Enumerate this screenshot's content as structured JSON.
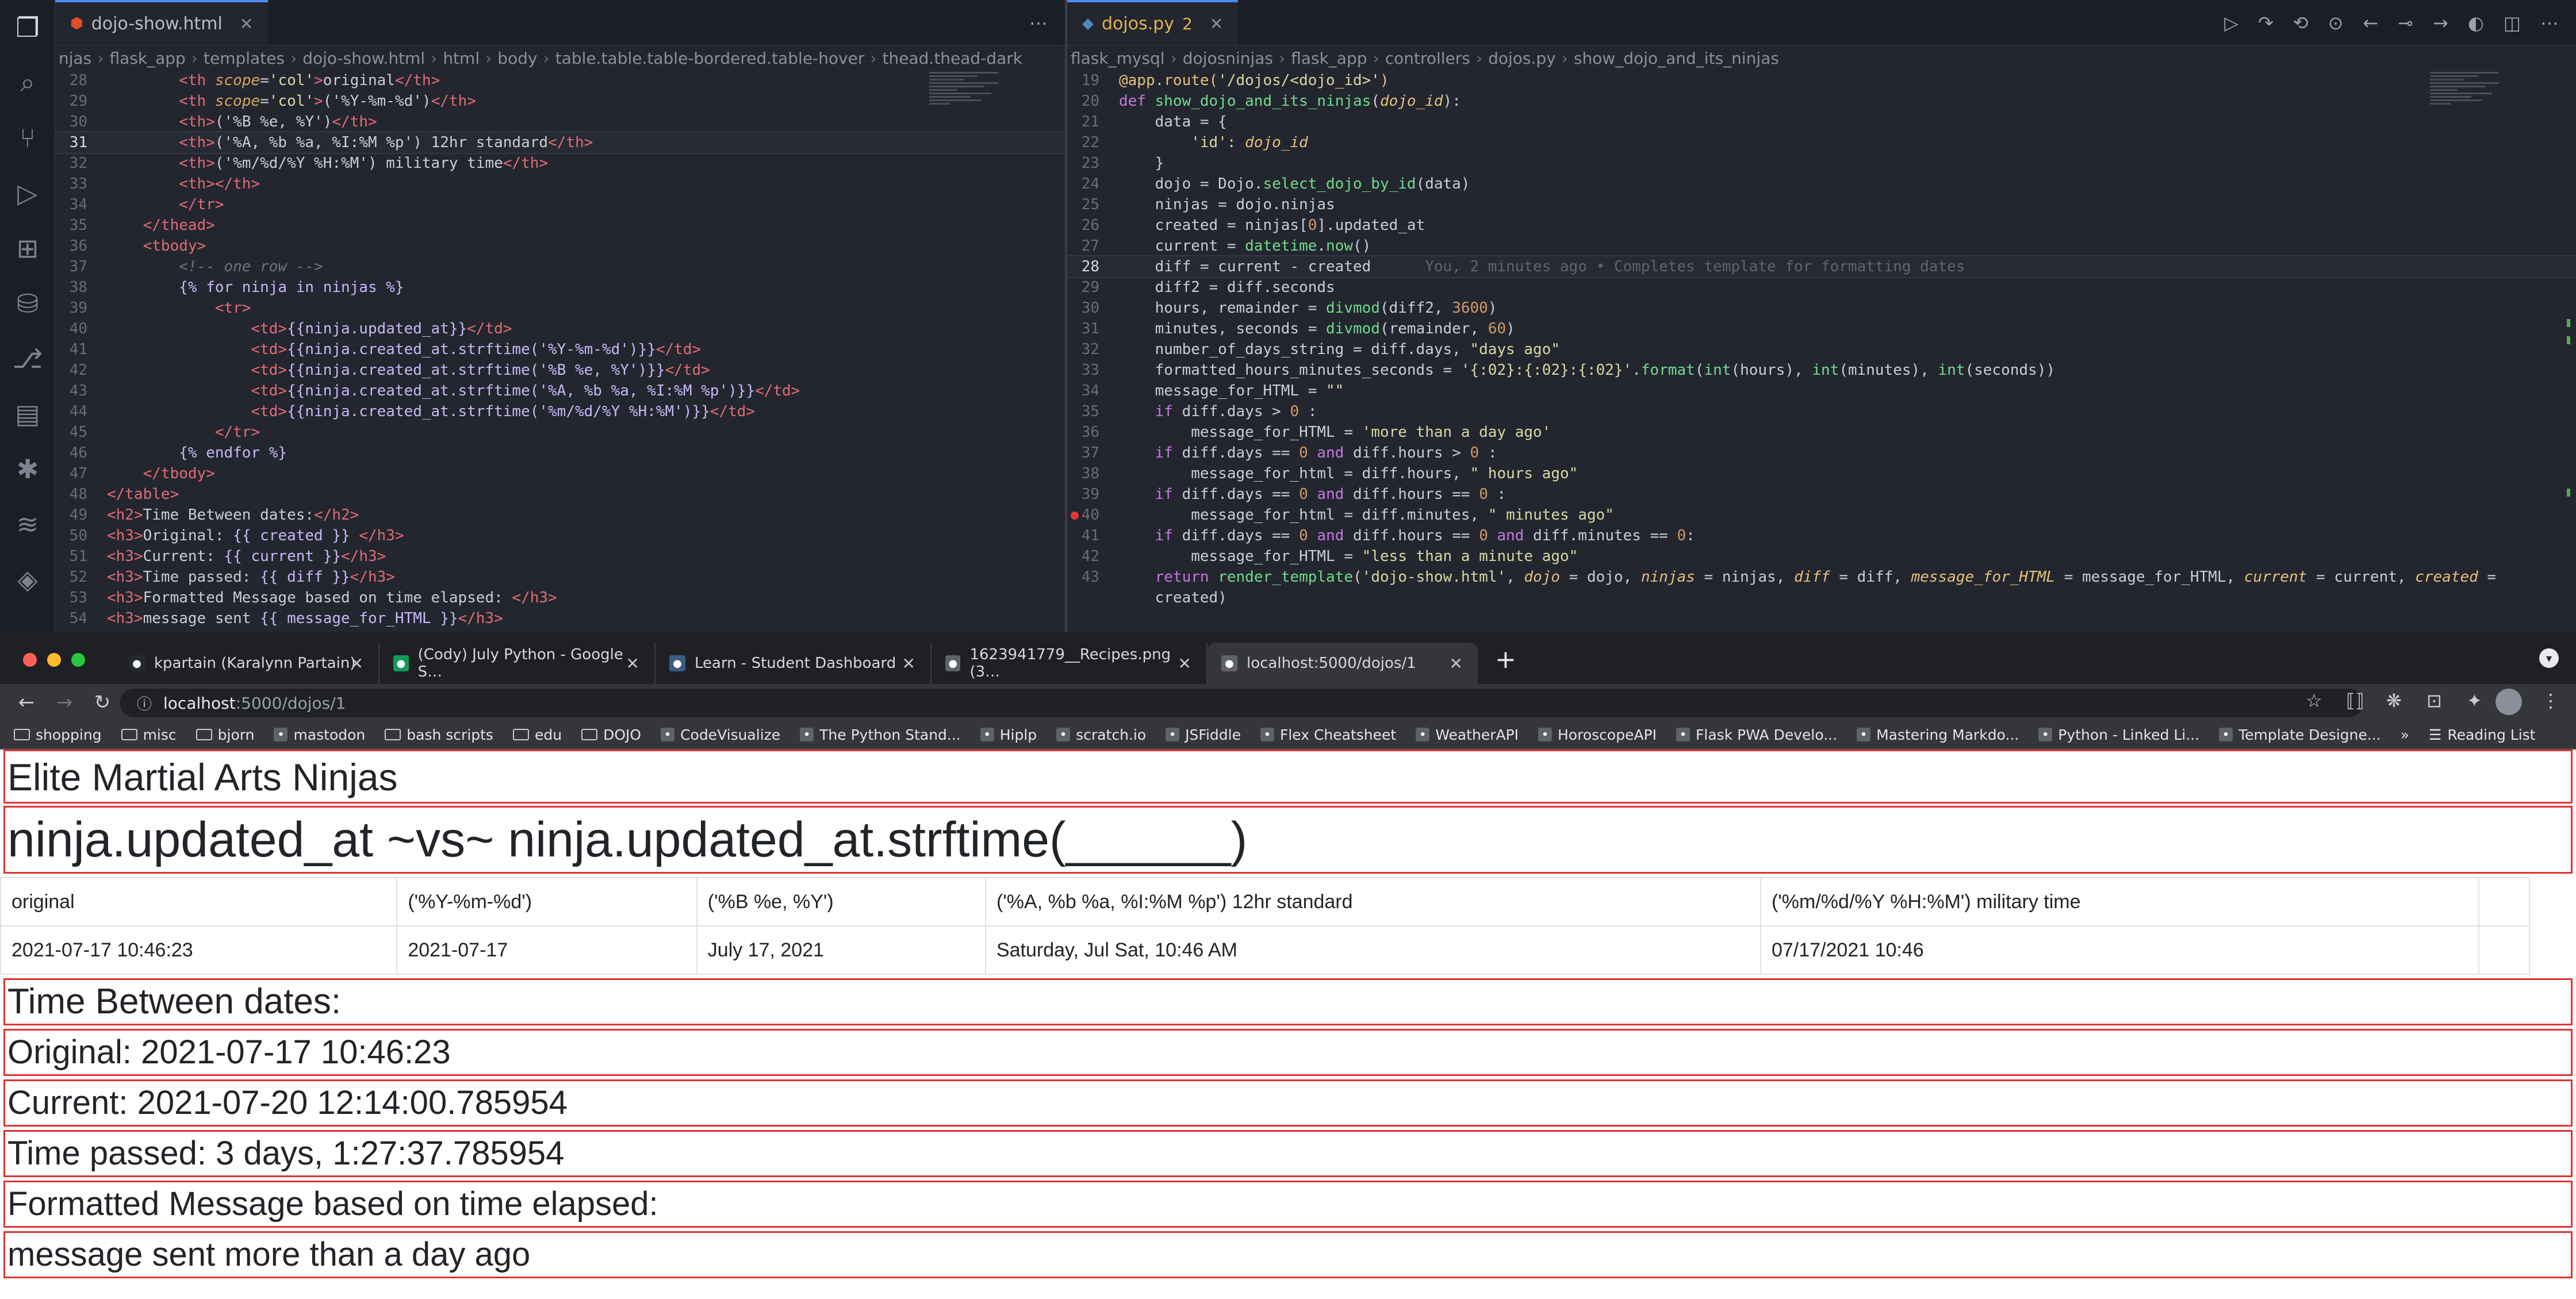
{
  "activity_bar": [
    "files-icon",
    "search-icon",
    "source-control-icon",
    "run-debug-icon",
    "extensions-icon",
    "database-icon",
    "git-graph-icon",
    "preview-icon",
    "paw-icon",
    "db-stack-icon",
    "layers-icon"
  ],
  "left_editor": {
    "tab_label": "dojo-show.html",
    "breadcrumbs": [
      "njas",
      "flask_app",
      "templates",
      "dojo-show.html",
      "html",
      "body",
      "table.table.table-bordered.table-hover",
      "thead.thead-dark"
    ],
    "lines": [
      {
        "n": "28",
        "html": "        <span class='t-tag'>&lt;th</span> <span class='t-attr'>scope</span>=<span class='t-str'>'col'</span><span class='t-tag'>&gt;</span>original<span class='t-tag'>&lt;/th&gt;</span>"
      },
      {
        "n": "29",
        "html": "        <span class='t-tag'>&lt;th</span> <span class='t-attr'>scope</span>=<span class='t-str'>'col'</span><span class='t-tag'>&gt;</span>('%Y-%m-%d')<span class='t-tag'>&lt;/th&gt;</span>"
      },
      {
        "n": "30",
        "html": "        <span class='t-tag'>&lt;th&gt;</span>('%B %e, %Y')<span class='t-tag'>&lt;/th&gt;</span>"
      },
      {
        "n": "31",
        "cur": true,
        "html": "        <span class='t-tag'>&lt;th&gt;</span>('%A, %b %a, %I:%M %p') 12hr standard<span class='t-tag'>&lt;/th&gt;</span>"
      },
      {
        "n": "32",
        "html": "        <span class='t-tag'>&lt;th&gt;</span>('%m/%d/%Y %H:%M') military time<span class='t-tag'>&lt;/th&gt;</span>"
      },
      {
        "n": "33",
        "html": "        <span class='t-tag'>&lt;th&gt;&lt;/th&gt;</span>"
      },
      {
        "n": "34",
        "html": "        <span class='t-tag'>&lt;/tr&gt;</span>"
      },
      {
        "n": "35",
        "html": "    <span class='t-tag'>&lt;/thead&gt;</span>"
      },
      {
        "n": "36",
        "html": "    <span class='t-tag'>&lt;tbody&gt;</span>"
      },
      {
        "n": "37",
        "html": "        <span class='t-com'>&lt;!-- one row --&gt;</span>"
      },
      {
        "n": "38",
        "html": "        <span class='t-tpl'>{% for ninja in ninjas %}</span>"
      },
      {
        "n": "39",
        "html": "            <span class='t-tag'>&lt;tr&gt;</span>"
      },
      {
        "n": "40",
        "html": "                <span class='t-tag'>&lt;td&gt;</span><span class='t-tpl'>{{ninja.updated_at}}</span><span class='t-tag'>&lt;/td&gt;</span>"
      },
      {
        "n": "41",
        "html": "                <span class='t-tag'>&lt;td&gt;</span><span class='t-tpl'>{{ninja.created_at.strftime('%Y-%m-%d')}}</span><span class='t-tag'>&lt;/td&gt;</span>"
      },
      {
        "n": "42",
        "html": "                <span class='t-tag'>&lt;td&gt;</span><span class='t-tpl'>{{ninja.created_at.strftime('%B %e, %Y')}}</span><span class='t-tag'>&lt;/td&gt;</span>"
      },
      {
        "n": "43",
        "html": "                <span class='t-tag'>&lt;td&gt;</span><span class='t-tpl'>{{ninja.created_at.strftime('%A, %b %a, %I:%M %p')}}</span><span class='t-tag'>&lt;/td&gt;</span>"
      },
      {
        "n": "44",
        "html": "                <span class='t-tag'>&lt;td&gt;</span><span class='t-tpl'>{{ninja.created_at.strftime('%m/%d/%Y %H:%M')}}</span><span class='t-tag'>&lt;/td&gt;</span>"
      },
      {
        "n": "45",
        "html": "            <span class='t-tag'>&lt;/tr&gt;</span>"
      },
      {
        "n": "46",
        "html": "        <span class='t-tpl'>{% endfor %}</span>"
      },
      {
        "n": "47",
        "html": "    <span class='t-tag'>&lt;/tbody&gt;</span>"
      },
      {
        "n": "48",
        "html": "<span class='t-tag'>&lt;/table&gt;</span>"
      },
      {
        "n": "49",
        "html": "<span class='t-tag'>&lt;h2&gt;</span>Time Between dates:<span class='t-tag'>&lt;/h2&gt;</span>"
      },
      {
        "n": "50",
        "html": "<span class='t-tag'>&lt;h3&gt;</span>Original: <span class='t-tpl'>{{ created }}</span> <span class='t-tag'>&lt;/h3&gt;</span>"
      },
      {
        "n": "51",
        "html": "<span class='t-tag'>&lt;h3&gt;</span>Current: <span class='t-tpl'>{{ current }}</span><span class='t-tag'>&lt;/h3&gt;</span>"
      },
      {
        "n": "52",
        "html": "<span class='t-tag'>&lt;h3&gt;</span>Time passed: <span class='t-tpl'>{{ diff }}</span><span class='t-tag'>&lt;/h3&gt;</span>"
      },
      {
        "n": "53",
        "html": "<span class='t-tag'>&lt;h3&gt;</span>Formatted Message based on time elapsed: <span class='t-tag'>&lt;/h3&gt;</span>"
      },
      {
        "n": "54",
        "html": "<span class='t-tag'>&lt;h3&gt;</span>message sent <span class='t-tpl'>{{ message_for_HTML }}</span><span class='t-tag'>&lt;/h3&gt;</span>"
      }
    ]
  },
  "right_editor": {
    "tab_label": "dojos.py",
    "tab_badge": "2",
    "breadcrumbs": [
      "flask_mysql",
      "dojosninjas",
      "flask_app",
      "controllers",
      "dojos.py",
      "show_dojo_and_its_ninjas"
    ],
    "lines": [
      {
        "n": "19",
        "html": "<span class='t-dec'>@app.route(</span><span class='t-str'>'/dojos/&lt;dojo_id&gt;'</span><span class='t-dec'>)</span>"
      },
      {
        "n": "20",
        "html": "<span class='t-kw'>def</span> <span class='t-fn'>show_dojo_and_its_ninjas</span>(<span class='t-param'>dojo_id</span>):"
      },
      {
        "n": "21",
        "html": "    data = {"
      },
      {
        "n": "22",
        "html": "        <span class='t-str'>'id'</span>: <span class='t-param'>dojo_id</span>"
      },
      {
        "n": "23",
        "html": "    }"
      },
      {
        "n": "24",
        "html": "    dojo = Dojo.<span class='t-fn'>select_dojo_by_id</span>(data)"
      },
      {
        "n": "25",
        "html": "    ninjas = dojo.ninjas"
      },
      {
        "n": "26",
        "html": "    created = ninjas[<span class='t-num'>0</span>].updated_at"
      },
      {
        "n": "27",
        "html": "    current = <span class='t-fn'>datetime</span>.<span class='t-fn'>now</span>()"
      },
      {
        "n": "28",
        "cur": true,
        "html": "    diff = current - created      <span class='t-blame'>You, 2 minutes ago • Completes template for formatting dates</span>"
      },
      {
        "n": "29",
        "html": "    diff2 = diff.seconds"
      },
      {
        "n": "30",
        "html": "    hours, remainder = <span class='t-fn'>divmod</span>(diff2, <span class='t-num'>3600</span>)"
      },
      {
        "n": "31",
        "html": "    minutes, seconds = <span class='t-fn'>divmod</span>(remainder, <span class='t-num'>60</span>)"
      },
      {
        "n": "32",
        "html": "    number_of_days_string = diff.days, <span class='t-str'>\"days ago\"</span>"
      },
      {
        "n": "33",
        "html": "    formatted_hours_minutes_seconds = <span class='t-str'>'{:02}:{:02}:{:02}'</span>.<span class='t-fn'>format</span>(<span class='t-fn'>int</span>(hours), <span class='t-fn'>int</span>(minutes), <span class='t-fn'>int</span>(seconds))"
      },
      {
        "n": "34",
        "html": "    message_for_HTML = <span class='t-str'>\"\"</span>"
      },
      {
        "n": "35",
        "html": "    <span class='t-kw'>if</span> diff.days &gt; <span class='t-num'>0</span> :"
      },
      {
        "n": "36",
        "html": "        message_for_HTML = <span class='t-str'>'more than a day ago'</span>"
      },
      {
        "n": "37",
        "html": "    <span class='t-kw'>if</span> diff.days == <span class='t-num'>0</span> <span class='t-kw'>and</span> diff.hours &gt; <span class='t-num'>0</span> :"
      },
      {
        "n": "38",
        "html": "        message_for_html = diff.hours, <span class='t-str'>\" hours ago\"</span>"
      },
      {
        "n": "39",
        "html": "    <span class='t-kw'>if</span> diff.days == <span class='t-num'>0</span> <span class='t-kw'>and</span> diff.hours == <span class='t-num'>0</span> :"
      },
      {
        "n": "40",
        "bp": true,
        "html": "        message_for_html = diff.minutes, <span class='t-str'>\" minutes ago\"</span>"
      },
      {
        "n": "41",
        "html": "    <span class='t-kw'>if</span> diff.days == <span class='t-num'>0</span> <span class='t-kw'>and</span> diff.hours == <span class='t-num'>0</span> <span class='t-kw'>and</span> diff.minutes == <span class='t-num'>0</span>:"
      },
      {
        "n": "42",
        "html": "        message_for_HTML = <span class='t-str'>\"less than a minute ago\"</span>"
      },
      {
        "n": "43",
        "html": "    <span class='t-kw'>return</span> <span class='t-fn'>render_template</span>(<span class='t-str'>'dojo-show.html'</span>, <span class='t-var'>dojo</span> = dojo, <span class='t-var'>ninjas</span> = ninjas, <span class='t-var'>diff</span> = diff, <span class='t-var'>message_for_HTML</span> = message_for_HTML, <span class='t-var'>current</span> = current, <span class='t-var'>created</span> ="
      },
      {
        "n": "",
        "html": "    created)"
      }
    ]
  },
  "browser": {
    "tabs": [
      {
        "label": "kpartain (Karalynn Partain)",
        "icon": "github-icon",
        "color": "#24292e"
      },
      {
        "label": "(Cody) July Python - Google S…",
        "icon": "sheets-icon",
        "color": "#0f9d58"
      },
      {
        "label": "Learn - Student Dashboard",
        "icon": "learn-icon",
        "color": "#3d5a80"
      },
      {
        "label": "1623941779__Recipes.png (3…",
        "icon": "globe-icon",
        "color": "#5f6368"
      },
      {
        "label": "localhost:5000/dojos/1",
        "icon": "page-icon",
        "color": "#5f6368"
      }
    ],
    "url_host": "localhost",
    "url_path": ":5000/dojos/1",
    "bookmarks": [
      "shopping",
      "misc",
      "bjorn",
      "mastodon",
      "bash scripts",
      "edu",
      "DOJO",
      "CodeVisualize",
      "The Python Stand...",
      "Hiplp",
      "scratch.io",
      "JSFiddle",
      "Flex Cheatsheet",
      "WeatherAPI",
      "HoroscopeAPI",
      "Flask PWA Develo...",
      "Mastering Markdo...",
      "Python - Linked Li...",
      "Template Designe..."
    ],
    "bookmarks_more": "»",
    "reading_list": "Reading List"
  },
  "page": {
    "title": "Elite Martial Arts Ninjas",
    "subtitle": "ninja.updated_at ~vs~ ninja.updated_at.strftime(______)",
    "table_headers": [
      "original",
      "('%Y-%m-%d')",
      "('%B %e, %Y')",
      "('%A, %b %a, %I:%M %p') 12hr standard",
      "('%m/%d/%Y %H:%M') military time",
      ""
    ],
    "table_rows": [
      [
        "2021-07-17 10:46:23",
        "2021-07-17",
        "July 17, 2021",
        "Saturday, Jul Sat, 10:46 AM",
        "07/17/2021 10:46",
        ""
      ]
    ],
    "time_between": "Time Between dates:",
    "original": "Original: 2021-07-17 10:46:23",
    "current": "Current: 2021-07-20 12:14:00.785954",
    "time_passed": "Time passed: 3 days, 1:27:37.785954",
    "formatted_label": "Formatted Message based on time elapsed:",
    "message": "message sent more than a day ago"
  },
  "colors": {
    "outline_red": "#e03232",
    "editor_bg": "#23262f",
    "accent_blue": "#4d8bf0"
  }
}
